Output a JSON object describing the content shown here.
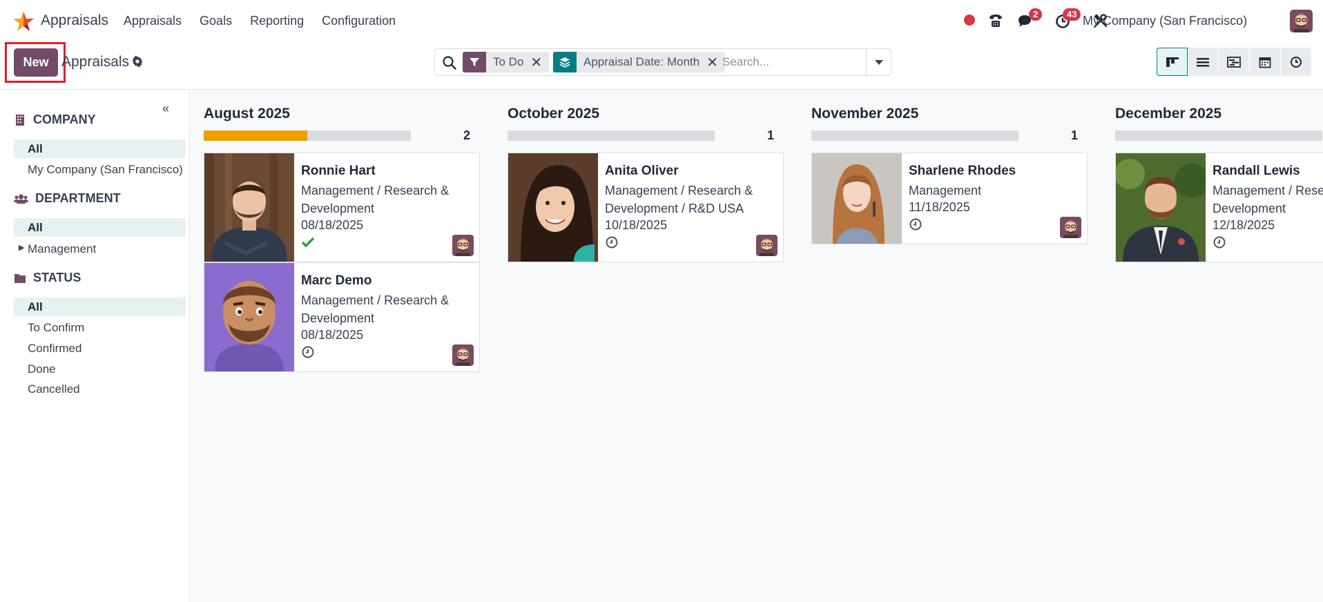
{
  "navbar": {
    "app_name": "Appraisals",
    "menu": [
      "Appraisals",
      "Goals",
      "Reporting",
      "Configuration"
    ],
    "messages_badge": "2",
    "activities_badge": "43",
    "company": "My Company (San Francisco)"
  },
  "control": {
    "new_label": "New",
    "breadcrumb": "Appraisals",
    "facets": [
      {
        "label": "To Do",
        "icon": "filter-icon",
        "color": "#714b67"
      },
      {
        "label": "Appraisal Date: Month",
        "icon": "group-by-icon",
        "color": "#017e84"
      }
    ],
    "search_placeholder": "Search...",
    "views": [
      "kanban-view",
      "list-view",
      "gantt-view",
      "calendar-view",
      "activity-view"
    ],
    "active_view": "kanban-view"
  },
  "sidepanel": {
    "sections": [
      {
        "title": "COMPANY",
        "icon": "building-icon",
        "items": [
          "All",
          "My Company (San Francisco)"
        ]
      },
      {
        "title": "DEPARTMENT",
        "icon": "users-icon",
        "items": [
          "All",
          "Management"
        ]
      },
      {
        "title": "STATUS",
        "icon": "folder-icon",
        "items": [
          "All",
          "To Confirm",
          "Confirmed",
          "Done",
          "Cancelled"
        ]
      }
    ]
  },
  "kanban": {
    "columns": [
      {
        "title": "August 2025",
        "count": "2",
        "progress": 0.5,
        "cards": [
          {
            "name": "Ronnie Hart",
            "department": "Management / Research & Development",
            "date": "08/18/2025",
            "state": "done"
          },
          {
            "name": "Marc Demo",
            "department": "Management / Research & Development",
            "date": "08/18/2025",
            "state": "pending"
          }
        ]
      },
      {
        "title": "October 2025",
        "count": "1",
        "progress": 0,
        "cards": [
          {
            "name": "Anita Oliver",
            "department": "Management / Research & Development / R&D USA",
            "date": "10/18/2025",
            "state": "pending"
          }
        ]
      },
      {
        "title": "November 2025",
        "count": "1",
        "progress": 0,
        "cards": [
          {
            "name": "Sharlene Rhodes",
            "department": "Management",
            "date": "11/18/2025",
            "state": "pending"
          }
        ]
      },
      {
        "title": "December 2025",
        "count": "",
        "progress": 0,
        "cards": [
          {
            "name": "Randall Lewis",
            "department": "Management / Research & Development",
            "date": "12/18/2025",
            "state": "pending"
          }
        ]
      }
    ]
  },
  "colors": {
    "brand": "#714b67",
    "teal": "#017e84",
    "progress": "#eba000",
    "badge": "#d63646",
    "highlight": "#e31d2b"
  }
}
